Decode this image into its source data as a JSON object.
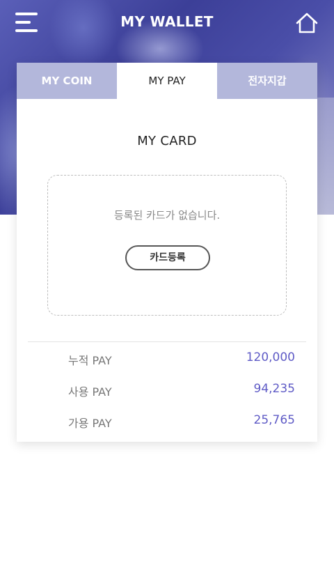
{
  "header": {
    "title": "MY WALLET",
    "menu_icon": "hamburger-menu-icon",
    "home_icon": "home-icon"
  },
  "tabs": [
    {
      "label": "MY COIN",
      "active": false
    },
    {
      "label": "MY PAY",
      "active": true
    },
    {
      "label": "전자지갑",
      "active": false
    }
  ],
  "card_section": {
    "title": "MY CARD",
    "empty_message": "등록된 카드가 없습니다.",
    "register_button": "카드등록"
  },
  "summary": [
    {
      "label": "누적 PAY",
      "value": "120,000"
    },
    {
      "label": "사용 PAY",
      "value": "94,235"
    },
    {
      "label": "가용 PAY",
      "value": "25,765"
    }
  ],
  "colors": {
    "accent": "#5f5bc6",
    "header_bg": "#4a4ea8",
    "inactive_tab": "#969bcd"
  }
}
